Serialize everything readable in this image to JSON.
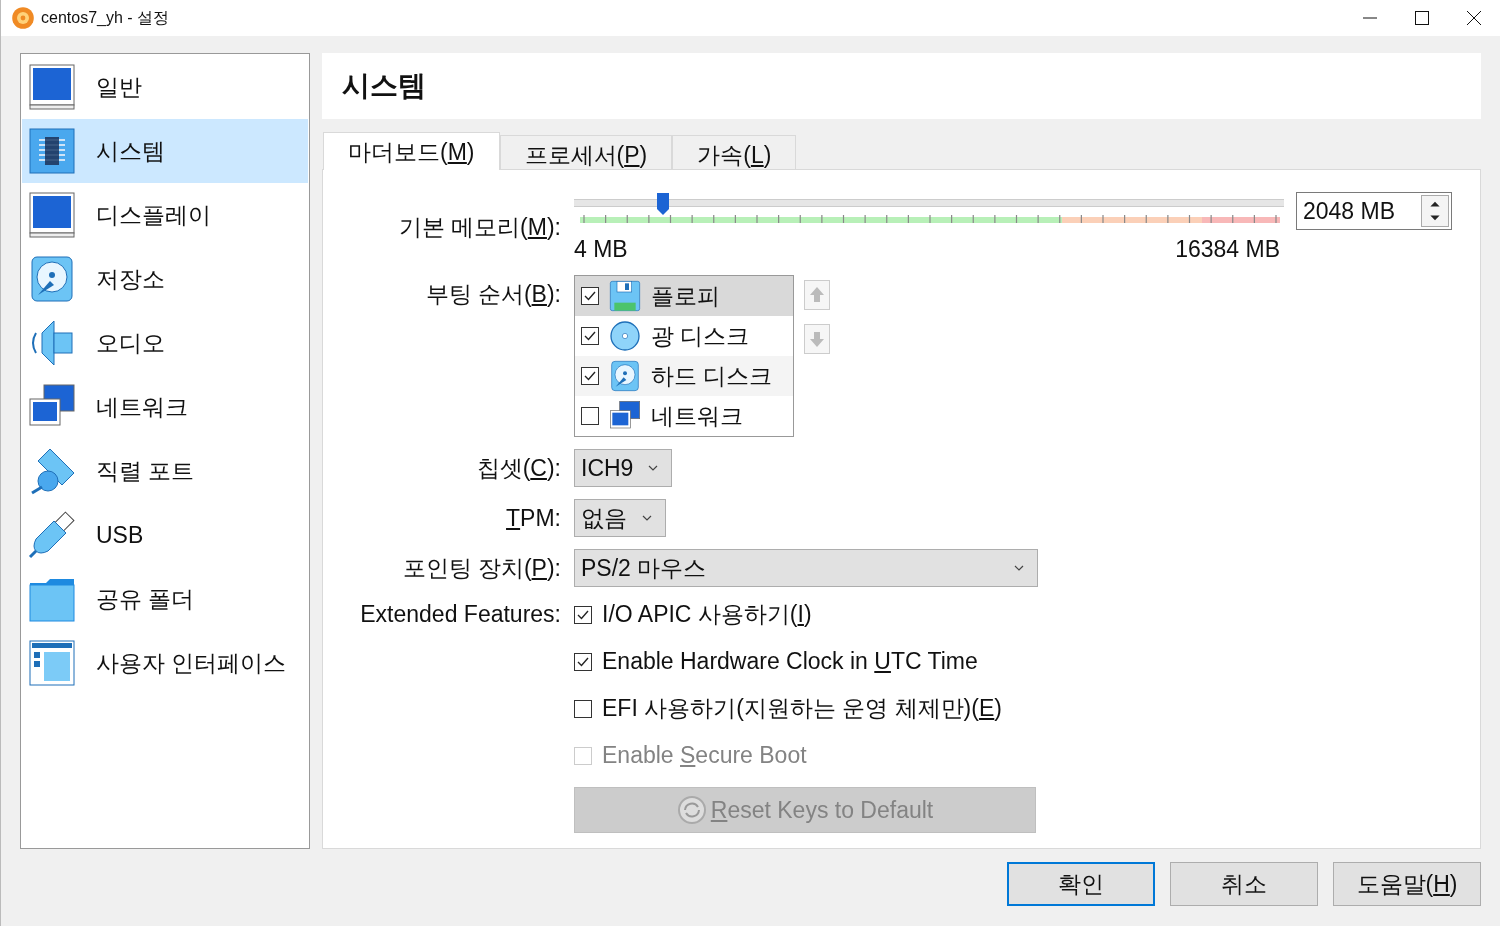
{
  "window": {
    "title": "centos7_yh - 설정"
  },
  "sidebar": {
    "items": [
      {
        "label": "일반",
        "selected": false
      },
      {
        "label": "시스템",
        "selected": true
      },
      {
        "label": "디스플레이",
        "selected": false
      },
      {
        "label": "저장소",
        "selected": false
      },
      {
        "label": "오디오",
        "selected": false
      },
      {
        "label": "네트워크",
        "selected": false
      },
      {
        "label": "직렬 포트",
        "selected": false
      },
      {
        "label": "USB",
        "selected": false
      },
      {
        "label": "공유 폴더",
        "selected": false
      },
      {
        "label": "사용자 인터페이스",
        "selected": false
      }
    ]
  },
  "page_title": "시스템",
  "tabs": [
    {
      "label": {
        "pre": "마더보드(",
        "key": "M",
        "post": ")"
      },
      "selected": true
    },
    {
      "label": {
        "pre": "프로세서(",
        "key": "P",
        "post": ")"
      },
      "selected": false
    },
    {
      "label": {
        "pre": "가속(",
        "key": "L",
        "post": ")"
      },
      "selected": false
    }
  ],
  "motherboard": {
    "memory": {
      "label": {
        "pre": "기본 메모리(",
        "key": "M",
        "post": "):"
      },
      "level": 0.125,
      "value": "2048 MB",
      "min_label": "4 MB",
      "max_label": "16384 MB"
    },
    "boot_order": {
      "label": {
        "pre": "부팅 순서(",
        "key": "B",
        "post": "):"
      },
      "items": [
        {
          "label": "플로피",
          "checked": true,
          "selected": true
        },
        {
          "label": "광 디스크",
          "checked": true,
          "selected": false
        },
        {
          "label": "하드 디스크",
          "checked": true,
          "selected": false
        },
        {
          "label": "네트워크",
          "checked": false,
          "selected": false
        }
      ]
    },
    "chipset": {
      "label": {
        "pre": "칩셋(",
        "key": "C",
        "post": "):"
      },
      "value": "ICH9"
    },
    "tpm": {
      "label": {
        "key": "T",
        "post": "PM:"
      },
      "value": "없음"
    },
    "pointing": {
      "label": {
        "pre": "포인팅 장치(",
        "key": "P",
        "post": "):"
      },
      "value": "PS/2 마우스"
    },
    "extended": {
      "label": {
        "pre": "Extended Features:"
      },
      "options": [
        {
          "label": {
            "pre": "I/O APIC 사용하기(",
            "key": "I",
            "post": ")"
          },
          "checked": true,
          "disabled": false
        },
        {
          "label": {
            "pre": "Enable Hardware Clock in ",
            "key": "U",
            "post": "TC Time"
          },
          "checked": true,
          "disabled": false
        },
        {
          "label": {
            "pre": "EFI 사용하기(지원하는 운영 체제만)(",
            "key": "E",
            "post": ")"
          },
          "checked": false,
          "disabled": false
        },
        {
          "label": {
            "pre": "Enable ",
            "key": "S",
            "post": "ecure Boot"
          },
          "checked": false,
          "disabled": true
        }
      ]
    },
    "reset_button": {
      "label": {
        "key": "R",
        "post": "eset Keys to Default"
      },
      "disabled": true
    }
  },
  "buttons": [
    {
      "label": {
        "pre": "확인"
      },
      "default": true
    },
    {
      "label": {
        "pre": "취소"
      },
      "default": false
    },
    {
      "label": {
        "pre": "도움말(",
        "key": "H",
        "post": ")"
      },
      "default": false
    }
  ]
}
